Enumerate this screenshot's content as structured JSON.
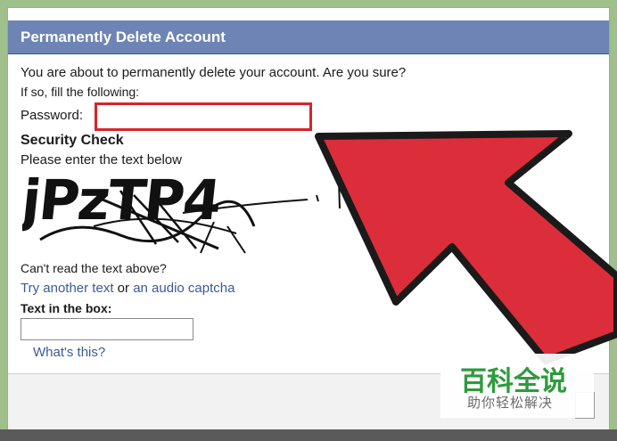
{
  "dialog": {
    "title": "Permanently Delete Account",
    "prompt": "You are about to permanently delete your account. Are you sure?",
    "instruction": "If so, fill the following:",
    "password_label": "Password:",
    "password_value": "",
    "security_heading": "Security Check",
    "security_instruction": "Please enter the text below",
    "captcha_text": "jPzTP4",
    "cant_read": "Can't read the text above?",
    "try_another": "Try another text",
    "or": "or",
    "audio_captcha": "an audio captcha",
    "text_in_box_label": "Text in the box:",
    "text_in_box_value": "",
    "whats_this": "What's this?"
  },
  "annotation": {
    "highlight_color": "#d8232a",
    "arrow_color": "#dc2d3b"
  },
  "watermark": {
    "title": "百科全说",
    "subtitle": "助你轻松解决"
  }
}
